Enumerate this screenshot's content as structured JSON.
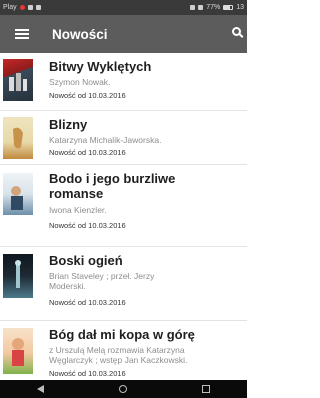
{
  "status_bar": {
    "left_text": "Play",
    "right_text": "77%",
    "time": "13"
  },
  "app_bar": {
    "menu_icon": "hamburger-menu-icon",
    "title": "Nowości",
    "search_icon": "search-icon"
  },
  "books": [
    {
      "title": "Bitwy Wyklętych",
      "author": "Szymon Nowak.",
      "date": "Nowość od 10.03.2016",
      "cover_colors": [
        "#c62828",
        "#3b4a5a"
      ]
    },
    {
      "title": "Blizny",
      "author": "Katarzyna Michalik-Jaworska.",
      "date": "Nowość od 10.03.2016",
      "cover_colors": [
        "#e8d9a8",
        "#c08a3e"
      ]
    },
    {
      "title_line1": "Bodo i jego burzliwe",
      "title_line2": "romanse",
      "author": "Iwona Kienzler.",
      "date": "Nowość od 10.03.2016",
      "cover_colors": [
        "#d9e3ea",
        "#6d8fa8"
      ]
    },
    {
      "title": "Boski ogień",
      "author_line1": "Brian Staveley ; przeł. Jerzy",
      "author_line2": "Moderski.",
      "date": "Nowość od 10.03.2016",
      "cover_colors": [
        "#1e2a35",
        "#4c7a8a"
      ]
    },
    {
      "title": "Bóg dał mi kopa w górę",
      "author_line1": "z Urszulą Melą rozmawia Katarzyna",
      "author_line2": "Węglarczyk ; wstęp Jan Kaczkowski.",
      "date": "Nowość od 10.03.2016",
      "cover_colors": [
        "#f3c8a0",
        "#7fb24c"
      ]
    }
  ],
  "nav_bar": {
    "back_icon": "back-triangle-icon",
    "home_icon": "home-circle-icon",
    "recent_icon": "recent-apps-square-icon"
  }
}
